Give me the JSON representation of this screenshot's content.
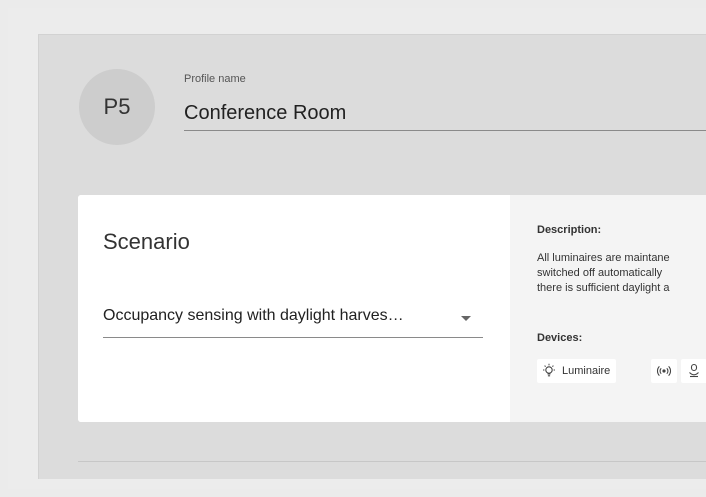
{
  "profile": {
    "avatar_text": "P5",
    "name_label": "Profile name",
    "name_value": "Conference Room"
  },
  "scenario": {
    "title": "Scenario",
    "selected": "Occupancy sensing with daylight harves…"
  },
  "description": {
    "heading": "Description:",
    "lines": [
      "All luminaires are maintane",
      "switched off automatically",
      "there is sufficient daylight a"
    ]
  },
  "devices": {
    "heading": "Devices:",
    "items": [
      {
        "label": "Luminaire",
        "icon": "luminaire-icon"
      },
      {
        "label": "",
        "icon": "sensor-icon"
      },
      {
        "label": "",
        "icon": "device-icon"
      }
    ]
  }
}
